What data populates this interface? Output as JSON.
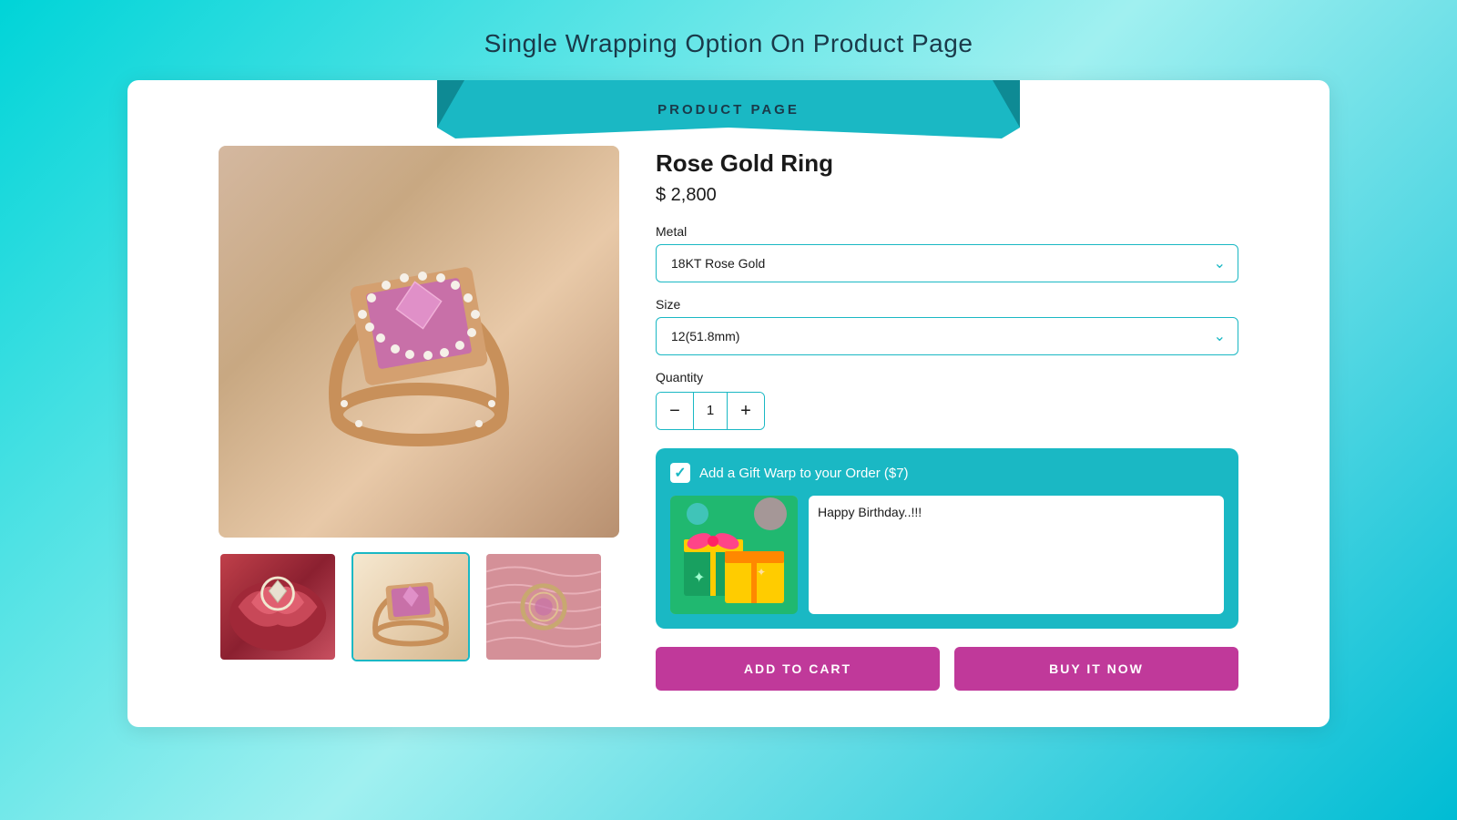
{
  "pageTitle": "Single Wrapping Option On Product Page",
  "banner": {
    "text": "PRODUCT PAGE"
  },
  "product": {
    "name": "Rose Gold Ring",
    "price": "$ 2,800",
    "metalLabel": "Metal",
    "metalValue": "18KT Rose Gold",
    "sizeLabel": "Size",
    "sizeValue": "12(51.8mm)",
    "quantityLabel": "Quantity",
    "quantityValue": "1",
    "quantityDecrease": "−",
    "quantityIncrease": "+"
  },
  "giftWrap": {
    "label": "Add a Gift Warp to your Order ($7)",
    "checked": true,
    "messageValue": "Happy Birthday..!!!"
  },
  "buttons": {
    "addToCart": "ADD TO CART",
    "buyItNow": "BUY IT NOW"
  }
}
